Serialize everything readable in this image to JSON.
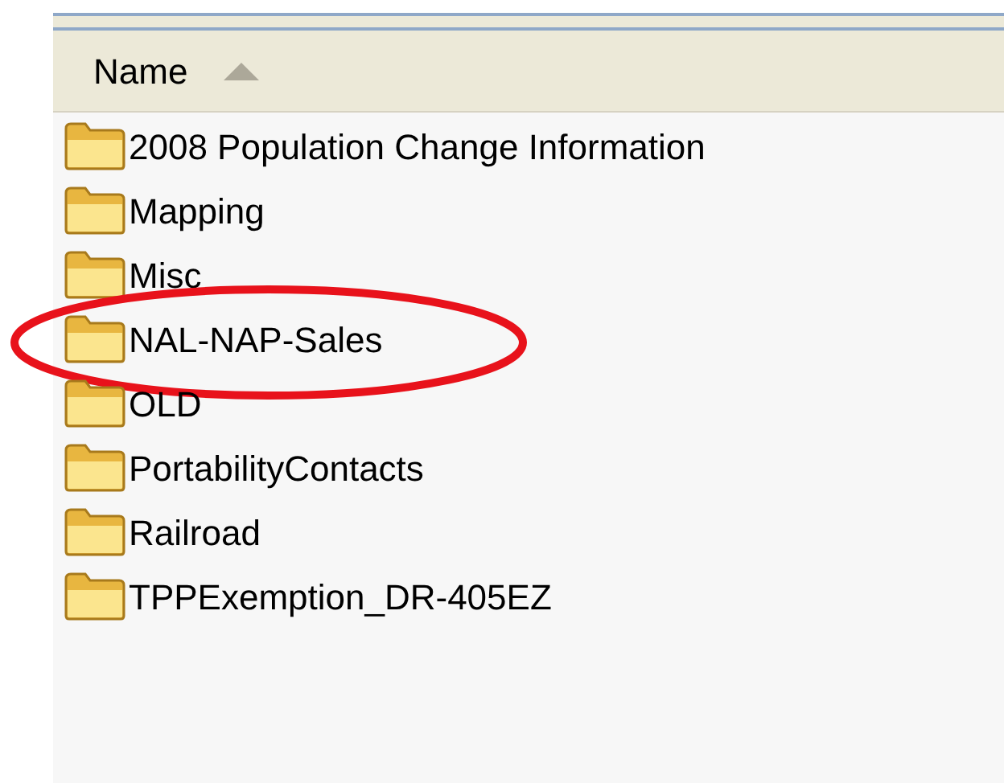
{
  "column_header": {
    "label": "Name",
    "sorted_ascending": true
  },
  "folders": [
    {
      "name": "2008 Population Change Information",
      "circled": false
    },
    {
      "name": "Mapping",
      "circled": false
    },
    {
      "name": "Misc",
      "circled": false
    },
    {
      "name": "NAL-NAP-Sales",
      "circled": true
    },
    {
      "name": "OLD",
      "circled": false
    },
    {
      "name": "PortabilityContacts",
      "circled": false
    },
    {
      "name": "Railroad",
      "circled": false
    },
    {
      "name": "TPPExemption_DR-405EZ",
      "circled": false
    }
  ]
}
